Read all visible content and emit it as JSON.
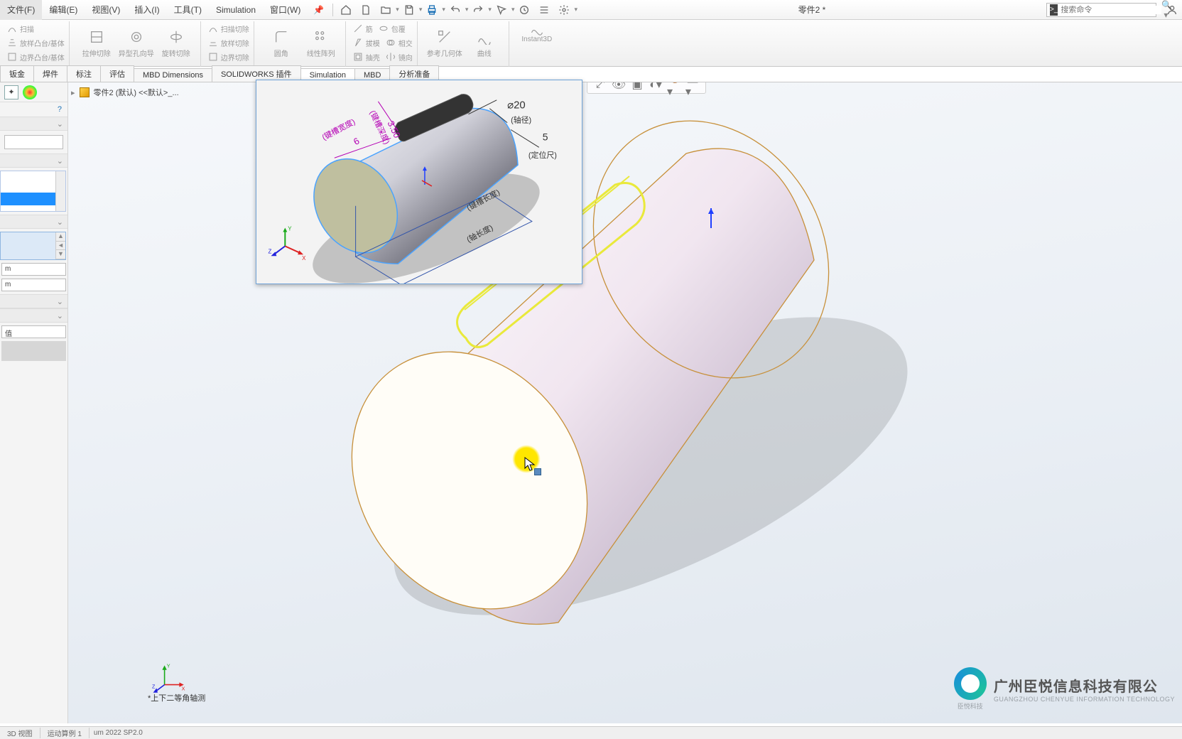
{
  "menus": {
    "file": "文件(F)",
    "edit": "编辑(E)",
    "view": "视图(V)",
    "insert": "插入(I)",
    "tools": "工具(T)",
    "simulation": "Simulation",
    "window": "窗口(W)"
  },
  "title": "零件2 *",
  "search": {
    "placeholder": "搜索命令"
  },
  "ribbon": {
    "sweep": "扫描",
    "loft_boss": "放样凸台/基体",
    "boundary_boss": "边界凸台/基体",
    "extrude_cut": "拉伸切除",
    "hole_wizard": "异型孔向导",
    "revolve_cut": "旋转切除",
    "sweep_cut": "扫描切除",
    "loft_cut": "放样切除",
    "boundary_cut": "边界切除",
    "fillet": "圆角",
    "linear_pattern": "线性阵列",
    "rib": "筋",
    "draft": "拔模",
    "shell": "抽壳",
    "wrap": "包覆",
    "intersect": "相交",
    "mirror": "镜向",
    "ref_geom": "参考几何体",
    "curves": "曲线",
    "instant3d": "Instant3D"
  },
  "tabs": {
    "sheetmetal": "钣金",
    "weldment": "焊件",
    "annotate": "标注",
    "evaluate": "评估",
    "mbd_dim": "MBD Dimensions",
    "sw_addins": "SOLIDWORKS 插件",
    "simulation": "Simulation",
    "mbd": "MBD",
    "analysis_prep": "分析准备"
  },
  "feature_tree": {
    "root": "零件2 (默认) <<默认>_..."
  },
  "prop_panel": {
    "unit1": "m",
    "unit2": "m",
    "val_label": "值"
  },
  "inset": {
    "dia_label": "⌀20",
    "ann_axis_dia": "(轴径)",
    "five": "5",
    "ann_loc": "(定位尺)",
    "depth_val": "3.50",
    "ann_depth": "(键槽深度)",
    "width_val": "6",
    "ann_width": "(键槽宽度)",
    "ann_slot_len": "(键槽长度)",
    "ann_axis_len": "(轴长度)"
  },
  "status_note": "*上下二等角轴测",
  "bottom": {
    "view3d": "3D 视图",
    "motion": "运动算例 1",
    "version": "um 2022 SP2.0"
  },
  "watermark": {
    "line1": "广州臣悦信息科技有限公",
    "line2": "GUANGZHOU CHENYUE INFORMATION TECHNOLOGY",
    "line3": "臣悦科技"
  },
  "colors": {
    "accent": "#1e90ff",
    "highlight": "#ffe600",
    "slot_outline": "#f2f23d"
  }
}
